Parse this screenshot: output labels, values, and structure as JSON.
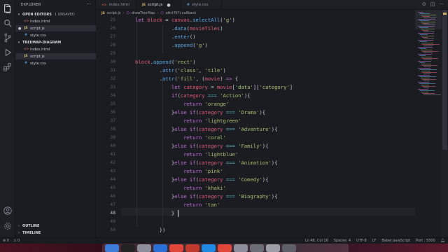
{
  "sidebar": {
    "title": "EXPLORER",
    "open_editors_label": "OPEN EDITORS",
    "open_editors_badge": "1 UNSAVED",
    "open_editors": [
      {
        "name": "index.html",
        "icon": "html"
      },
      {
        "name": "script.js",
        "icon": "js"
      },
      {
        "name": "style.css",
        "icon": "css"
      }
    ],
    "folder_label": "TREEMAP-DIAGRAM",
    "folder_files": [
      {
        "name": "index.html",
        "icon": "html"
      },
      {
        "name": "script.js",
        "icon": "js"
      },
      {
        "name": "style.css",
        "icon": "css"
      }
    ],
    "outline_label": "OUTLINE",
    "timeline_label": "TIMELINE"
  },
  "tabs": [
    {
      "name": "index.html",
      "icon": "html",
      "active": false
    },
    {
      "name": "script.js",
      "icon": "js",
      "active": true
    },
    {
      "name": "style.css",
      "icon": "css",
      "active": false
    }
  ],
  "breadcrumb": [
    "script.js",
    "drawTreeMap",
    "attr('fill') callback"
  ],
  "editor": {
    "line_numbers": [
      "25",
      "26",
      "27",
      "28",
      "29",
      "30",
      "31",
      "32",
      "33",
      "34",
      "35",
      "36",
      "37",
      "38",
      "39",
      "40",
      "41",
      "42",
      "43",
      "44",
      "45",
      "46",
      "47",
      "48",
      "49",
      "50"
    ],
    "current_line": "48"
  },
  "statusbar": {
    "left_items": [
      "⊗ 0",
      "⚠ 0"
    ],
    "right_items": [
      "Ln 48, Col 16",
      "Spaces: 4",
      "UTF-8",
      "LF",
      "Babel JavaScript",
      "Port : 5500"
    ]
  },
  "colors": {
    "keyword": "#c56edb",
    "function": "#57a9e8",
    "string": "#a7c46d",
    "variable": "#e45a73"
  }
}
